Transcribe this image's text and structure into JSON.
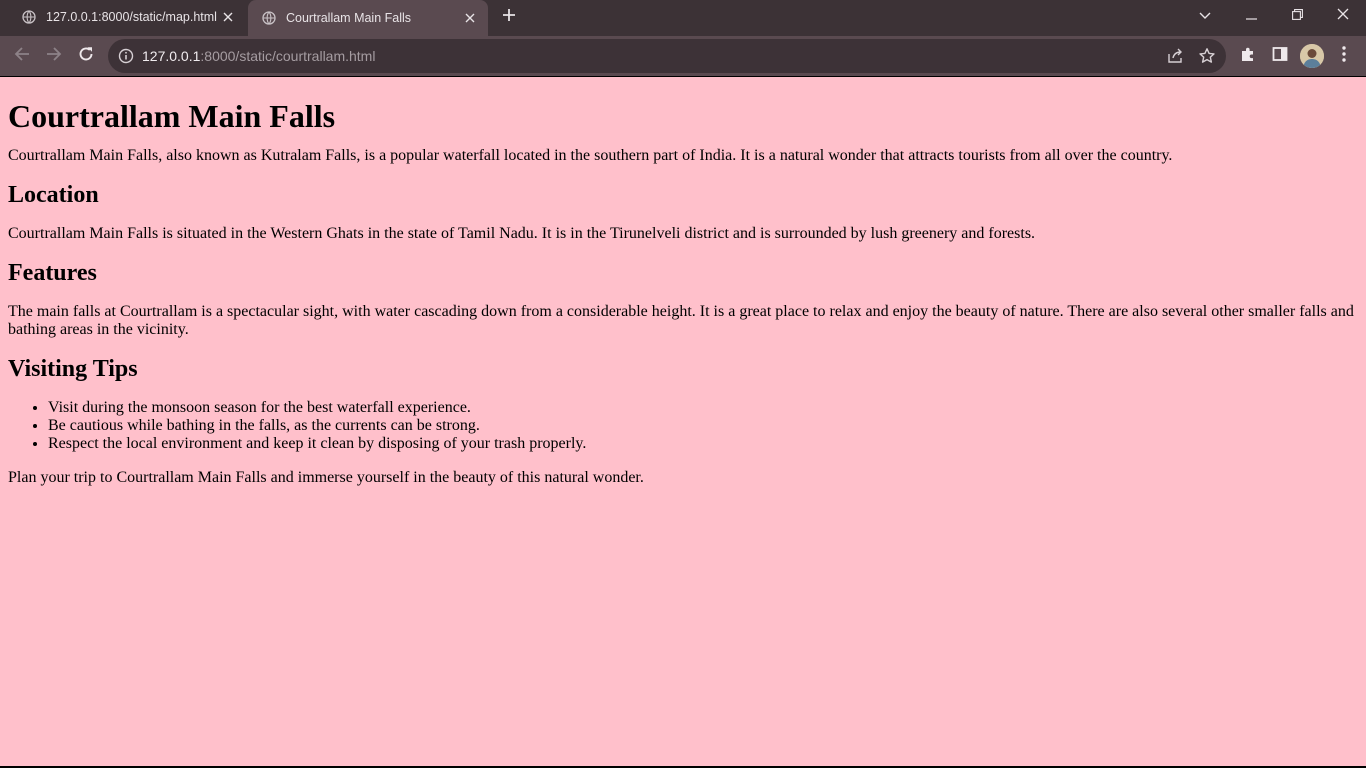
{
  "browser": {
    "tabs": [
      {
        "title": "127.0.0.1:8000/static/map.html",
        "active": false
      },
      {
        "title": "Courtrallam Main Falls",
        "active": true
      }
    ],
    "url": {
      "host": "127.0.0.1",
      "rest": ":8000/static/courtrallam.html"
    }
  },
  "page": {
    "title": "Courtrallam Main Falls",
    "intro": "Courtrallam Main Falls, also known as Kutralam Falls, is a popular waterfall located in the southern part of India. It is a natural wonder that attracts tourists from all over the country.",
    "location": {
      "heading": "Location",
      "text": "Courtrallam Main Falls is situated in the Western Ghats in the state of Tamil Nadu. It is in the Tirunelveli district and is surrounded by lush greenery and forests."
    },
    "features": {
      "heading": "Features",
      "text": "The main falls at Courtrallam is a spectacular sight, with water cascading down from a considerable height. It is a great place to relax and enjoy the beauty of nature. There are also several other smaller falls and bathing areas in the vicinity."
    },
    "tips": {
      "heading": "Visiting Tips",
      "items": [
        "Visit during the monsoon season for the best waterfall experience.",
        "Be cautious while bathing in the falls, as the currents can be strong.",
        "Respect the local environment and keep it clean by disposing of your trash properly."
      ]
    },
    "closing": "Plan your trip to Courtrallam Main Falls and immerse yourself in the beauty of this natural wonder."
  },
  "colors": {
    "page_background": "#ffc0cb",
    "tabstrip": "#3c3236",
    "toolbar": "#5a4a50",
    "omnibox": "#3d3237"
  },
  "icons": [
    "globe-icon",
    "close-icon",
    "plus-icon",
    "chevron-down-icon",
    "minimize-icon",
    "restore-icon",
    "window-close-icon",
    "back-arrow-icon",
    "forward-arrow-icon",
    "reload-icon",
    "info-icon",
    "share-icon",
    "star-icon",
    "extensions-icon",
    "side-panel-icon",
    "avatar",
    "kebab-menu-icon"
  ]
}
